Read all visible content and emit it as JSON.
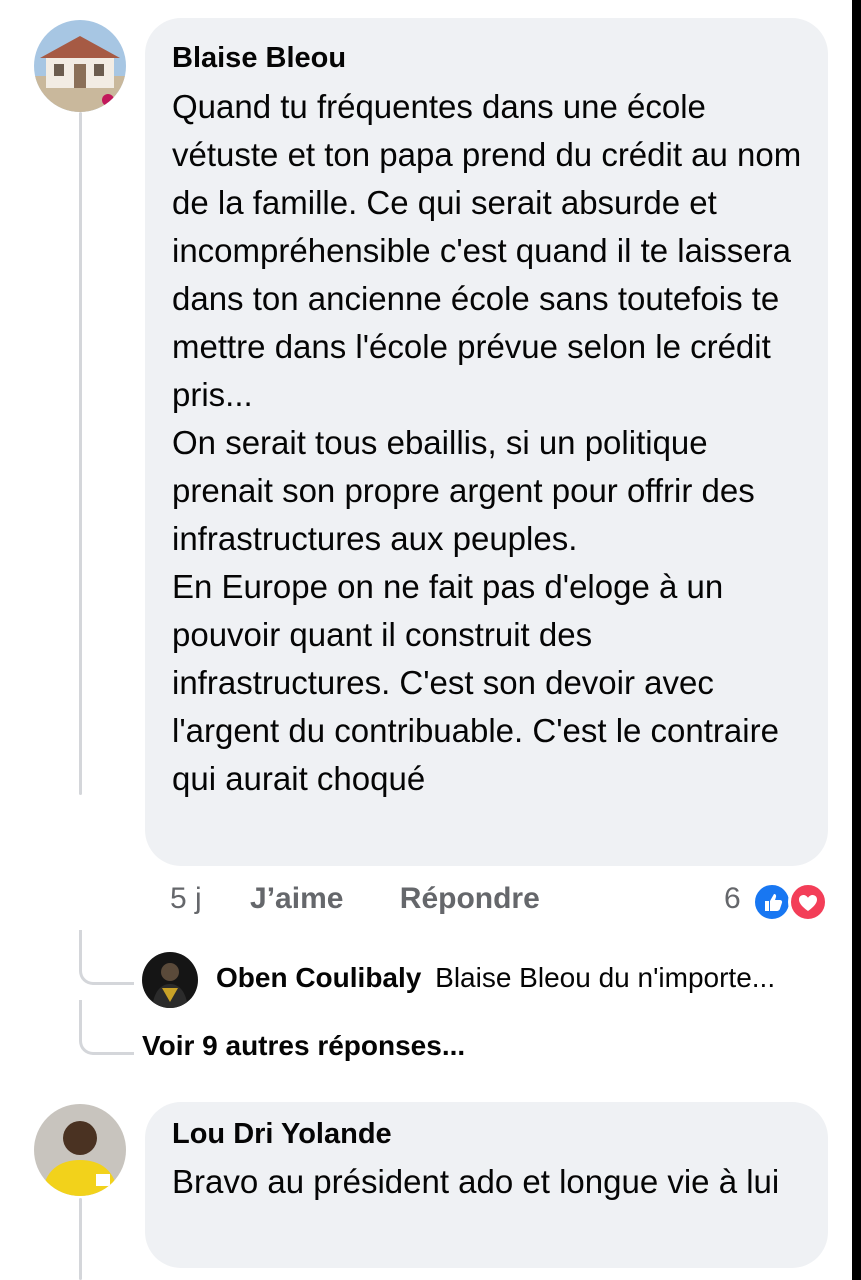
{
  "comments": [
    {
      "author": "Blaise Bleou",
      "paragraphs": [
        "Quand tu fréquentes dans une école vétuste et ton papa prend du crédit au nom de la famille. Ce qui serait absurde et incompréhensible c'est quand il te laissera dans ton ancienne école sans toutefois te mettre dans l'école prévue selon le crédit pris...",
        "On serait tous ebaillis, si un politique prenait son propre argent pour offrir des infrastructures aux peuples.",
        "En Europe on ne fait pas d'eloge à un pouvoir quant il construit des infrastructures. C'est son devoir avec l'argent du contribuable. C'est le contraire qui aurait choqué"
      ],
      "time": "5 j",
      "like_label": "J’aime",
      "reply_label": "Répondre",
      "reaction_count": "6",
      "reactions": [
        "like-icon",
        "love-icon"
      ],
      "reply_preview": {
        "author": "Oben Coulibaly",
        "snippet": "Blaise Bleou du n'importe..."
      },
      "more_replies": "Voir 9 autres réponses..."
    },
    {
      "author": "Lou Dri Yolande",
      "paragraphs": [
        "Bravo au président ado et longue vie à lui"
      ]
    }
  ],
  "colors": {
    "bubble": "#eff1f4",
    "like_blue": "#1877f2",
    "love_red": "#f33e58",
    "muted_text": "#65676b"
  }
}
